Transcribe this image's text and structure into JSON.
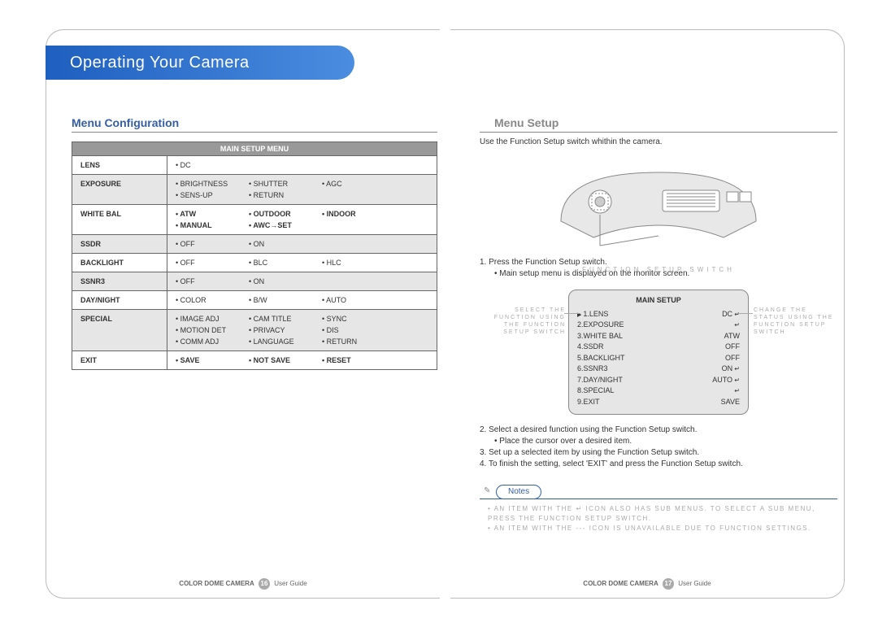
{
  "title": "Operating Your Camera",
  "left": {
    "section": "Menu Configuration",
    "tableHeader": "MAIN SETUP MENU",
    "rows": [
      {
        "label": "LENS",
        "alt": false,
        "cols": 1,
        "vals": [
          "DC"
        ]
      },
      {
        "label": "EXPOSURE",
        "alt": true,
        "cols": 3,
        "vals": [
          "BRIGHTNESS",
          "SHUTTER",
          "AGC",
          "SENS-UP",
          "RETURN",
          ""
        ]
      },
      {
        "label": "WHITE BAL",
        "alt": false,
        "cols": 3,
        "bold": true,
        "vals": [
          "ATW",
          "OUTDOOR",
          "INDOOR",
          "MANUAL",
          "AWC→SET",
          ""
        ]
      },
      {
        "label": "SSDR",
        "alt": true,
        "cols": 2,
        "vals": [
          "OFF",
          "ON"
        ]
      },
      {
        "label": "BACKLIGHT",
        "alt": false,
        "cols": 3,
        "vals": [
          "OFF",
          "BLC",
          "HLC"
        ]
      },
      {
        "label": "SSNR3",
        "alt": true,
        "cols": 2,
        "vals": [
          "OFF",
          "ON"
        ]
      },
      {
        "label": "DAY/NIGHT",
        "alt": false,
        "cols": 3,
        "vals": [
          "COLOR",
          "B/W",
          "AUTO"
        ]
      },
      {
        "label": "SPECIAL",
        "alt": true,
        "cols": 3,
        "vals": [
          "IMAGE ADJ",
          "CAM TITLE",
          "SYNC",
          "MOTION DET",
          "PRIVACY",
          "DIS",
          "COMM ADJ",
          "LANGUAGE",
          "RETURN"
        ]
      },
      {
        "label": "EXIT",
        "alt": false,
        "cols": 3,
        "bold": true,
        "vals": [
          "SAVE",
          "NOT SAVE",
          "RESET"
        ]
      }
    ]
  },
  "right": {
    "section": "Menu Setup",
    "intro": "Use the Function Setup switch whithin the camera.",
    "diagram_caption": "FUNCTION SETUP SWITCH",
    "step1": "1. Press the Function Setup switch.",
    "step1sub": "• Main setup menu is displayed on the monitor screen.",
    "mainsetup": {
      "title": "MAIN SETUP",
      "items": [
        {
          "n": "1.LENS",
          "v": "DC",
          "cursor": true,
          "arrow": true
        },
        {
          "n": "2.EXPOSURE",
          "v": "",
          "arrow": true
        },
        {
          "n": "3.WHITE BAL",
          "v": "ATW"
        },
        {
          "n": "4.SSDR",
          "v": "OFF"
        },
        {
          "n": "5.BACKLIGHT",
          "v": "OFF"
        },
        {
          "n": "6.SSNR3",
          "v": "ON",
          "arrow": true
        },
        {
          "n": "7.DAY/NIGHT",
          "v": "AUTO",
          "arrow": true
        },
        {
          "n": "8.SPECIAL",
          "v": "",
          "arrow": true
        },
        {
          "n": "9.EXIT",
          "v": "SAVE"
        }
      ],
      "leftnote": "SELECT THE FUNCTION USING THE FUNCTION SETUP SWITCH",
      "rightnote": "CHANGE THE STATUS USING THE FUNCTION SETUP SWITCH"
    },
    "steps": [
      "2. Select a desired function using the Function Setup switch.",
      "   • Place the cursor over a desired item.",
      "3. Set up a selected item by using the Function Setup switch.",
      "4. To finish the setting, select 'EXIT' and press the Function Setup switch."
    ],
    "notes_label": "Notes",
    "notes": [
      "• AN ITEM WITH THE ↵ ICON ALSO HAS SUB MENUS. TO SELECT A SUB MENU, PRESS THE FUNCTION SETUP SWITCH.",
      "• AN ITEM WITH THE --- ICON IS UNAVAILABLE DUE TO FUNCTION SETTINGS."
    ]
  },
  "footer": {
    "product": "COLOR DOME CAMERA",
    "guide": "User Guide",
    "pageLeft": "16",
    "pageRight": "17"
  }
}
